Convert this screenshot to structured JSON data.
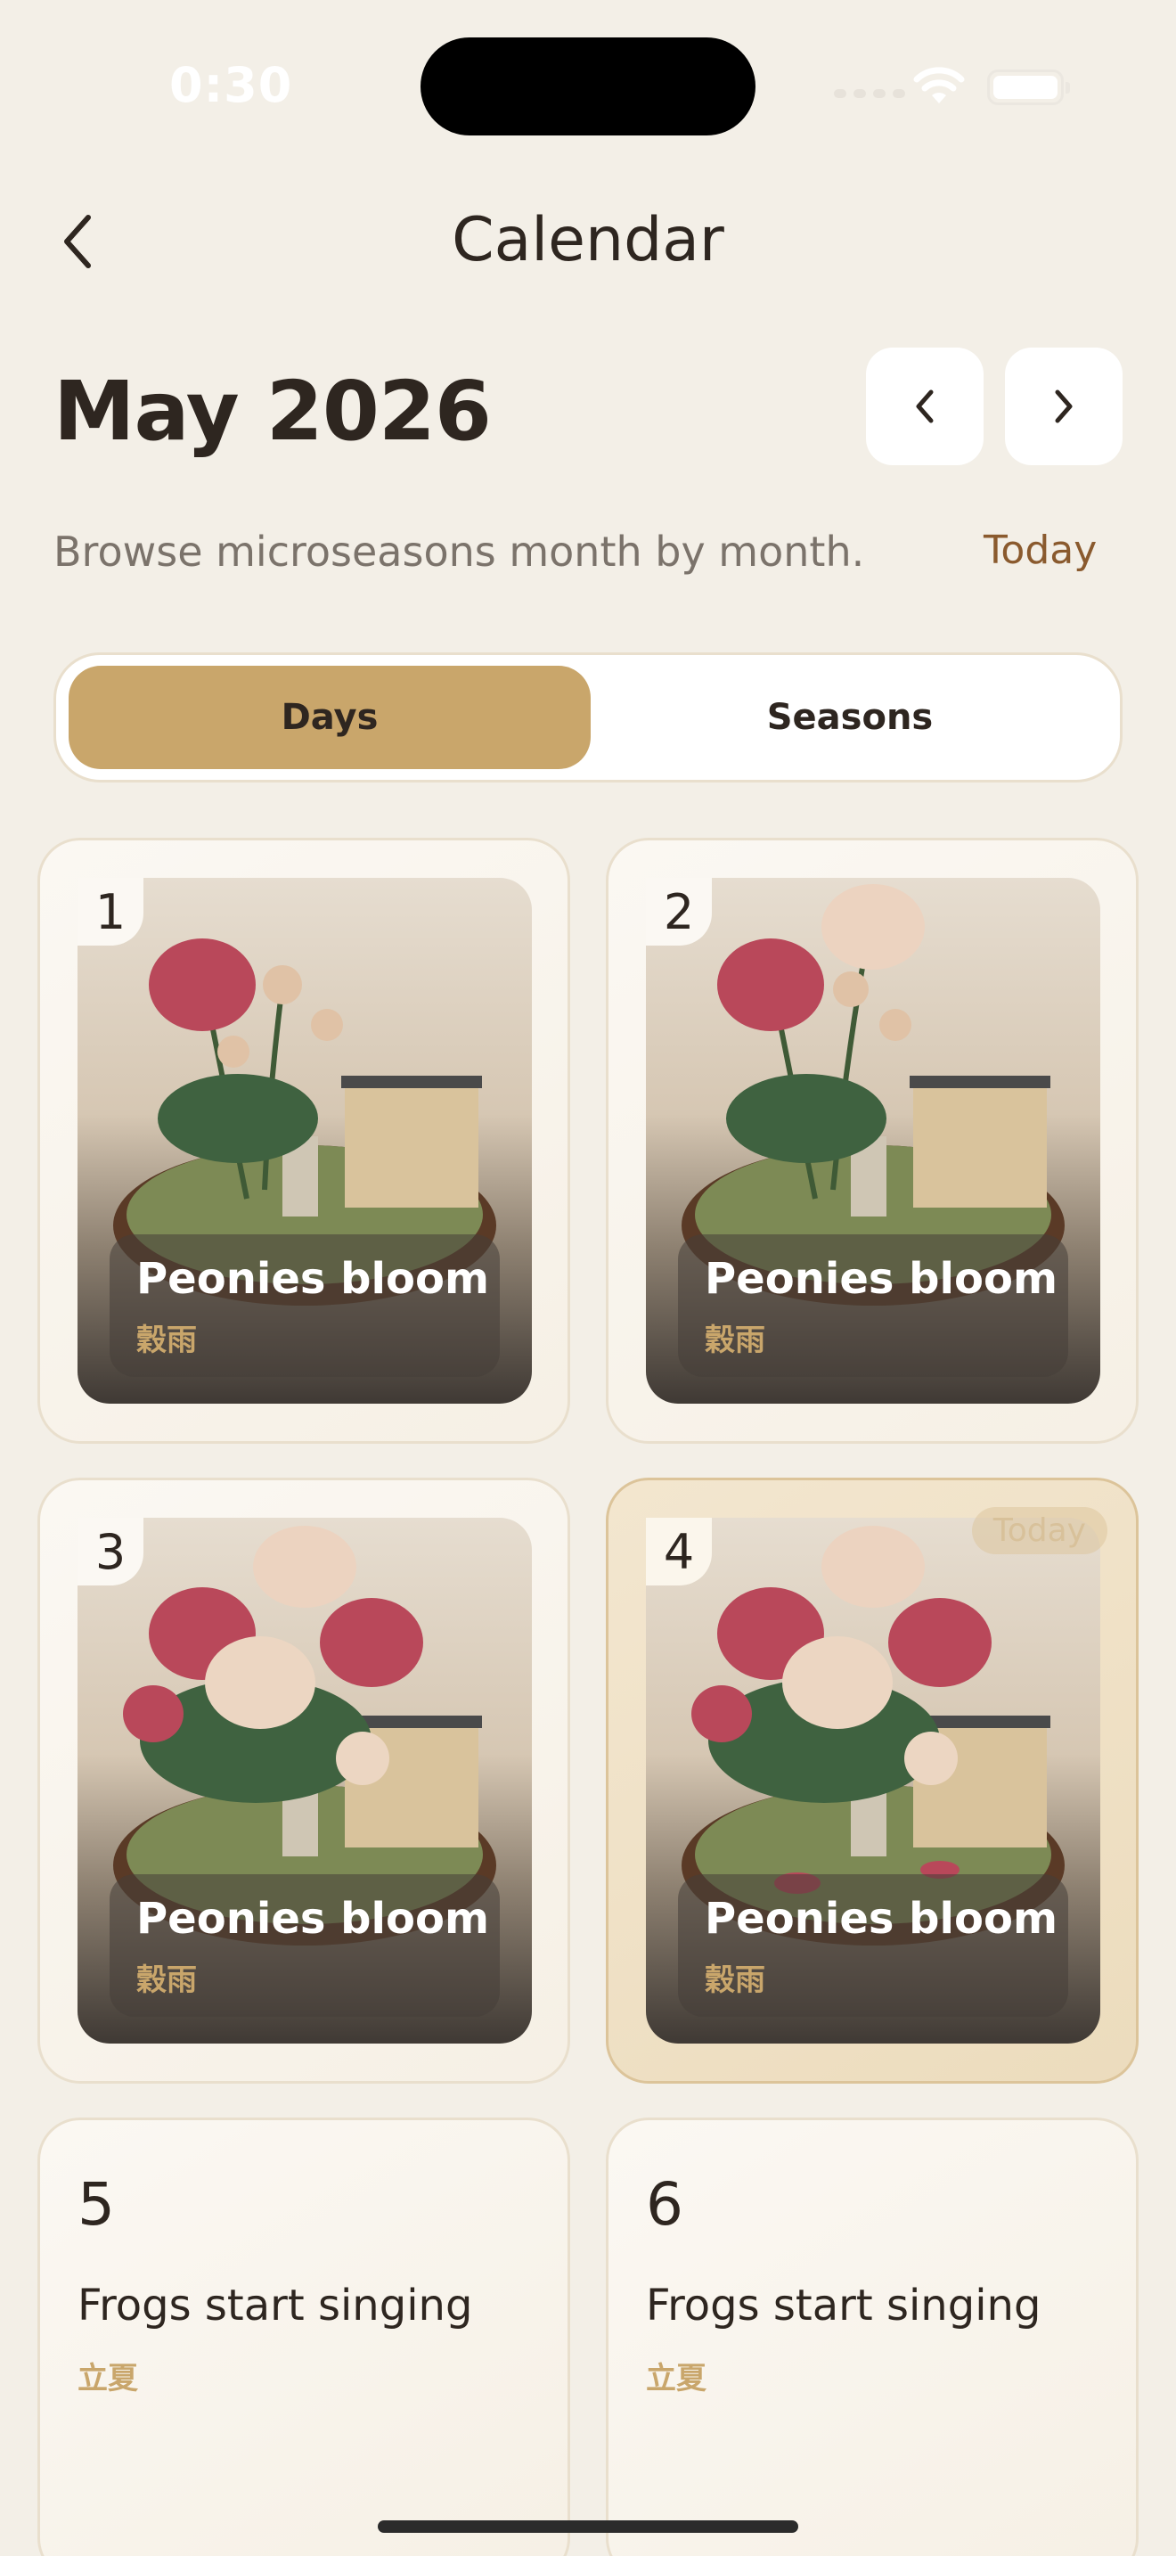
{
  "status": {
    "time": "0:30"
  },
  "nav": {
    "title": "Calendar"
  },
  "header": {
    "month": "May 2026",
    "subtitle": "Browse microseasons month by month.",
    "today_link": "Today"
  },
  "segments": {
    "days": "Days",
    "seasons": "Seasons",
    "selected": "Days"
  },
  "days": [
    {
      "day": "1",
      "title": "Peonies bloom",
      "kanji": "穀雨"
    },
    {
      "day": "2",
      "title": "Peonies bloom",
      "kanji": "穀雨"
    },
    {
      "day": "3",
      "title": "Peonies bloom",
      "kanji": "穀雨"
    },
    {
      "day": "4",
      "title": "Peonies bloom",
      "kanji": "穀雨",
      "badge": "Today"
    },
    {
      "day": "5",
      "title": "Frogs start singing",
      "kanji": "立夏"
    },
    {
      "day": "6",
      "title": "Frogs start singing",
      "kanji": "立夏"
    }
  ],
  "colors": {
    "background": "#f3efe7",
    "accent": "#c9a66b",
    "today_link": "#8a5a2e",
    "text": "#2e2620"
  }
}
